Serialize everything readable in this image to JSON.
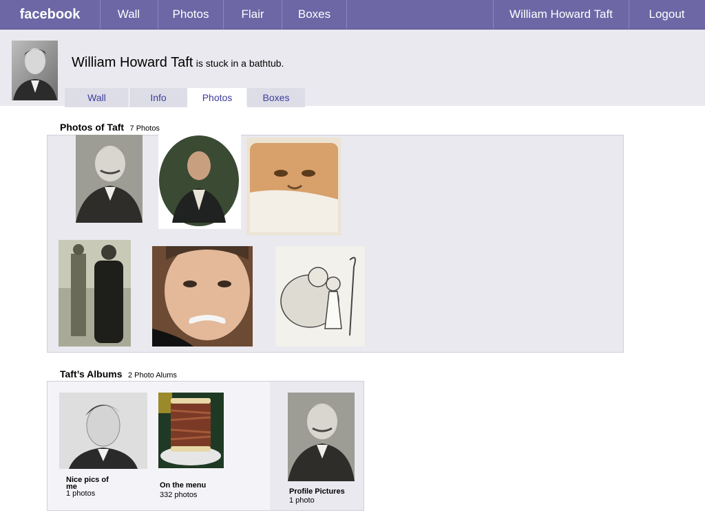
{
  "topbar": {
    "logo": "facebook",
    "nav": [
      "Wall",
      "Photos",
      "Flair",
      "Boxes"
    ],
    "user": "William Howard Taft",
    "logout": "Logout"
  },
  "profile": {
    "name": "William Howard Taft",
    "status": "is stuck in a bathtub.",
    "tabs": [
      "Wall",
      "Info",
      "Photos",
      "Boxes"
    ],
    "active_tab": "Photos"
  },
  "photos_section": {
    "title": "Photos of Taft",
    "count": "7 Photos"
  },
  "albums_section": {
    "title": "Taft’s Albums",
    "count": "2 Photo Alums",
    "albums": [
      {
        "name": "Nice pics of me",
        "count": "1 photos"
      },
      {
        "name": "On the menu",
        "count": "332 photos"
      },
      {
        "name": "Profile Pictures",
        "count": "1 photo"
      }
    ]
  },
  "colors": {
    "topbar": "#6d67a6",
    "band": "#e9e9ef",
    "tab_text": "#3b3b9c"
  }
}
